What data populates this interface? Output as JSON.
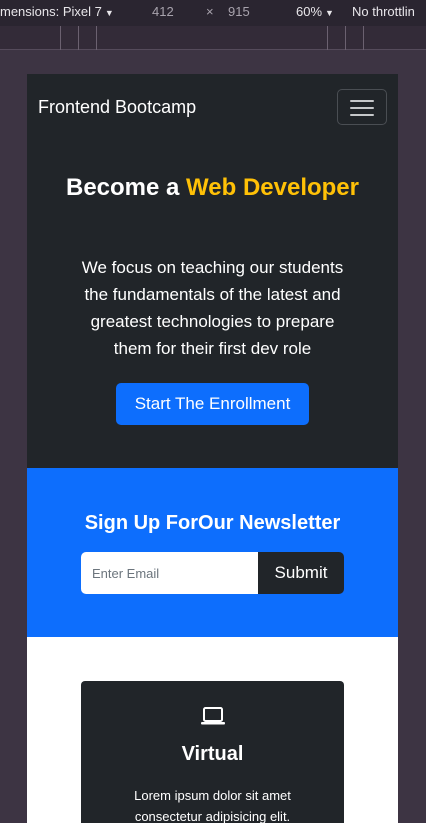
{
  "devtools": {
    "dimensions_label": "mensions: Pixel 7",
    "width": "412",
    "times": "×",
    "height": "915",
    "zoom": "60%",
    "throttling": "No throttlin"
  },
  "navbar": {
    "brand": "Frontend Bootcamp",
    "toggler_icon": "hamburger-icon"
  },
  "hero": {
    "title_prefix": "Become a ",
    "title_accent": "Web Developer",
    "text": "We focus on teaching our students the fundamentals of the latest and greatest technologies to prepare them for their first dev role",
    "button": "Start The Enrollment"
  },
  "newsletter": {
    "title": "Sign Up ForOur Newsletter",
    "placeholder": "Enter Email",
    "submit": "Submit"
  },
  "card": {
    "icon": "laptop-icon",
    "title": "Virtual",
    "text": "Lorem ipsum dolor sit amet consectetur adipisicing elit."
  },
  "colors": {
    "dark": "#212529",
    "primary": "#0d6efd",
    "warning": "#ffc107"
  }
}
